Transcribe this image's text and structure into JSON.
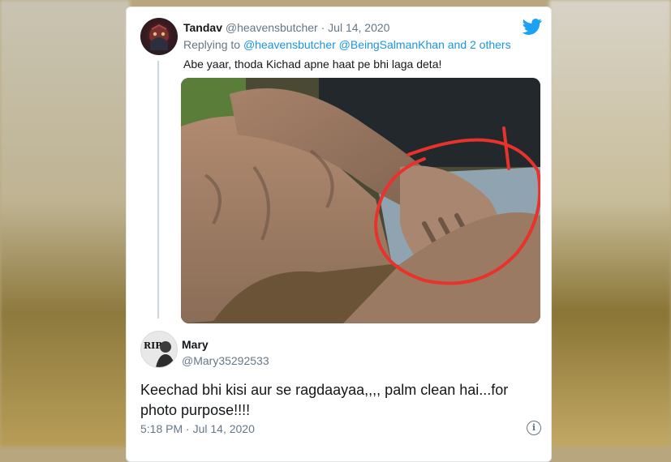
{
  "tweet1": {
    "display_name": "Tandav",
    "handle": "@heavensbutcher",
    "separator": " · ",
    "date": "Jul 14, 2020",
    "replying_prefix": "Replying to ",
    "replying_handles": "@heavensbutcher @BeingSalmanKhan",
    "replying_suffix": " and 2 others",
    "text": "Abe yaar, thoda Kichad apne haat pe bhi laga deta!",
    "image_icon": "photo-of-muddy-legs-with-red-circle"
  },
  "tweet2": {
    "display_name": "Mary",
    "handle": "@Mary35292533",
    "avatar_text": "RIP",
    "text": "Keechad bhi kisi aur se ragdaayaa,,,,  palm clean hai...for photo purpose!!!!",
    "timestamp": "5:18 PM · Jul 14, 2020"
  },
  "icons": {
    "brand": "twitter-bird-icon",
    "info": "info-icon"
  },
  "colors": {
    "brand_blue": "#1da1f2",
    "link_blue": "#1b95e0",
    "muted_gray": "#657786",
    "annotation_red": "#e8322c"
  }
}
